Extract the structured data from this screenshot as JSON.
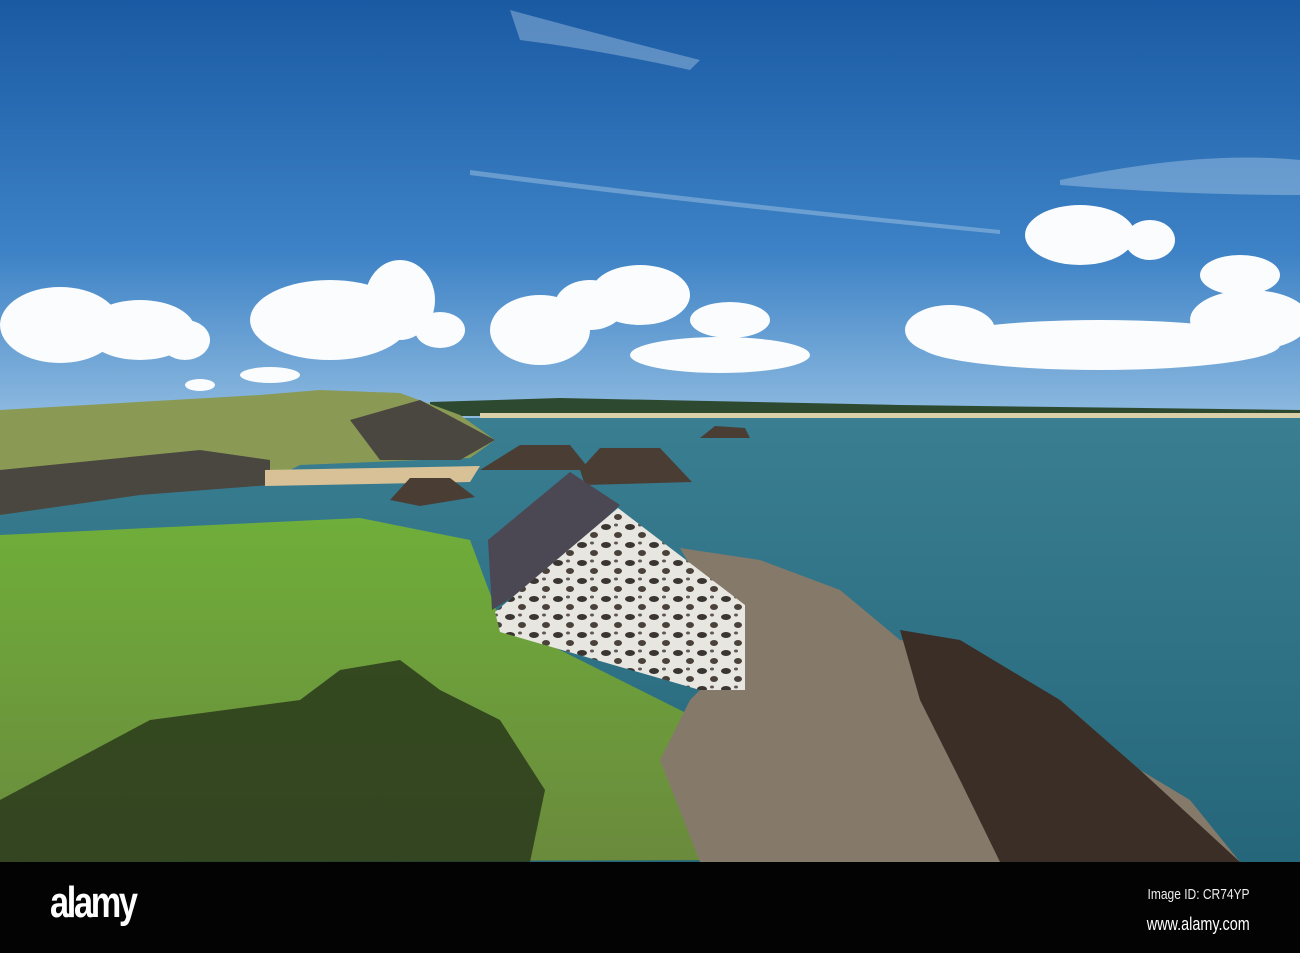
{
  "footer": {
    "logo": "alamy",
    "image_id": "Image ID: CR74YP",
    "website": "www.alamy.com"
  },
  "colors": {
    "sky_top": "#1c5fa8",
    "sky_horizon": "#6ea6d8",
    "sea": "#2f6e80",
    "grass": "#5f9a34",
    "footer_bg": "#030303"
  }
}
